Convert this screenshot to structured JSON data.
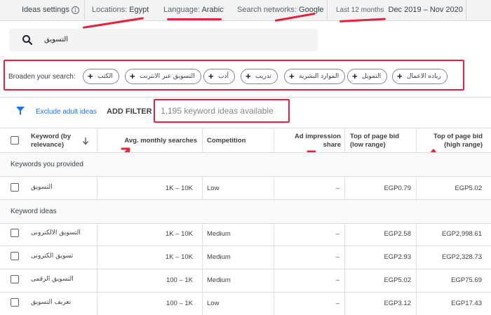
{
  "topbar": {
    "ideas_settings": "Ideas settings",
    "locations_key": "Locations:",
    "locations_val": "Egypt",
    "language_key": "Language:",
    "language_val": "Arabic",
    "networks_key": "Search networks:",
    "networks_val": "Google",
    "period_key": "Last 12 months",
    "period_val": "Dec 2019 – Nov 2020"
  },
  "search": {
    "query": "التسويق"
  },
  "broaden": {
    "label": "Broaden your search:",
    "chips": [
      "الكتب",
      "التسويق عبر الانترنت",
      "أدب",
      "تدريب",
      "الموارد البشرية",
      "التمويل",
      "رياده الاعمال"
    ]
  },
  "filters": {
    "exclude_adult": "Exclude adult ideas",
    "add_filter": "ADD FILTER",
    "count": "1,195 keyword ideas available"
  },
  "table": {
    "headers": {
      "keyword": "Keyword (by relevance)",
      "searches": "Avg. monthly searches",
      "competition": "Competition",
      "impression": "Ad impression share",
      "bid_low": "Top of page bid (low range)",
      "bid_high": "Top of page bid (high range)"
    },
    "group_provided": "Keywords you provided",
    "group_ideas": "Keyword ideas",
    "provided_rows": [
      {
        "keyword": "التسويق",
        "searches": "1K – 10K",
        "competition": "Low",
        "impression": "–",
        "bid_low": "EGP0.79",
        "bid_high": "EGP5.02"
      }
    ],
    "idea_rows": [
      {
        "keyword": "التسويق الالكترونى",
        "searches": "1K – 10K",
        "competition": "Medium",
        "impression": "–",
        "bid_low": "EGP2.58",
        "bid_high": "EGP2,998.61"
      },
      {
        "keyword": "تسويق الكترونى",
        "searches": "1K – 10K",
        "competition": "Medium",
        "impression": "–",
        "bid_low": "EGP2.93",
        "bid_high": "EGP2,328.73"
      },
      {
        "keyword": "التسويق الرقمى",
        "searches": "100 – 1K",
        "competition": "Medium",
        "impression": "–",
        "bid_low": "EGP5.02",
        "bid_high": "EGP75.69"
      },
      {
        "keyword": "تعريف التسويق",
        "searches": "100 – 1K",
        "competition": "Low",
        "impression": "–",
        "bid_low": "EGP3.12",
        "bid_high": "EGP17.43"
      }
    ]
  },
  "colors": {
    "annotation": "#e8203a",
    "link": "#1a73e8",
    "bar": "#f1f3f4"
  },
  "icons": [
    "info-icon",
    "search-icon",
    "plus-icon",
    "filter-icon",
    "sort-down-arrow-icon",
    "checkbox-icon"
  ]
}
